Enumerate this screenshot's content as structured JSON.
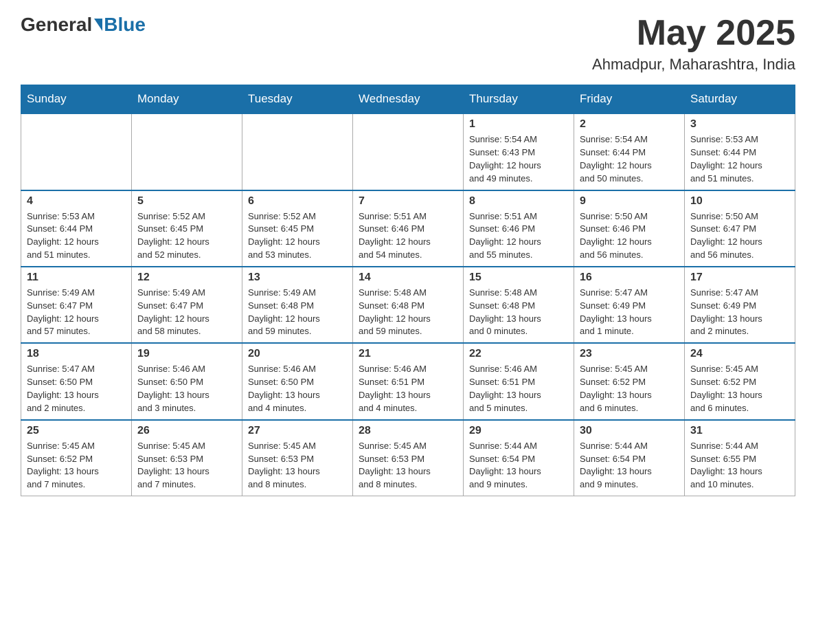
{
  "logo": {
    "general": "General",
    "blue": "Blue"
  },
  "title": "May 2025",
  "location": "Ahmadpur, Maharashtra, India",
  "headers": [
    "Sunday",
    "Monday",
    "Tuesday",
    "Wednesday",
    "Thursday",
    "Friday",
    "Saturday"
  ],
  "weeks": [
    [
      {
        "day": "",
        "info": ""
      },
      {
        "day": "",
        "info": ""
      },
      {
        "day": "",
        "info": ""
      },
      {
        "day": "",
        "info": ""
      },
      {
        "day": "1",
        "info": "Sunrise: 5:54 AM\nSunset: 6:43 PM\nDaylight: 12 hours\nand 49 minutes."
      },
      {
        "day": "2",
        "info": "Sunrise: 5:54 AM\nSunset: 6:44 PM\nDaylight: 12 hours\nand 50 minutes."
      },
      {
        "day": "3",
        "info": "Sunrise: 5:53 AM\nSunset: 6:44 PM\nDaylight: 12 hours\nand 51 minutes."
      }
    ],
    [
      {
        "day": "4",
        "info": "Sunrise: 5:53 AM\nSunset: 6:44 PM\nDaylight: 12 hours\nand 51 minutes."
      },
      {
        "day": "5",
        "info": "Sunrise: 5:52 AM\nSunset: 6:45 PM\nDaylight: 12 hours\nand 52 minutes."
      },
      {
        "day": "6",
        "info": "Sunrise: 5:52 AM\nSunset: 6:45 PM\nDaylight: 12 hours\nand 53 minutes."
      },
      {
        "day": "7",
        "info": "Sunrise: 5:51 AM\nSunset: 6:46 PM\nDaylight: 12 hours\nand 54 minutes."
      },
      {
        "day": "8",
        "info": "Sunrise: 5:51 AM\nSunset: 6:46 PM\nDaylight: 12 hours\nand 55 minutes."
      },
      {
        "day": "9",
        "info": "Sunrise: 5:50 AM\nSunset: 6:46 PM\nDaylight: 12 hours\nand 56 minutes."
      },
      {
        "day": "10",
        "info": "Sunrise: 5:50 AM\nSunset: 6:47 PM\nDaylight: 12 hours\nand 56 minutes."
      }
    ],
    [
      {
        "day": "11",
        "info": "Sunrise: 5:49 AM\nSunset: 6:47 PM\nDaylight: 12 hours\nand 57 minutes."
      },
      {
        "day": "12",
        "info": "Sunrise: 5:49 AM\nSunset: 6:47 PM\nDaylight: 12 hours\nand 58 minutes."
      },
      {
        "day": "13",
        "info": "Sunrise: 5:49 AM\nSunset: 6:48 PM\nDaylight: 12 hours\nand 59 minutes."
      },
      {
        "day": "14",
        "info": "Sunrise: 5:48 AM\nSunset: 6:48 PM\nDaylight: 12 hours\nand 59 minutes."
      },
      {
        "day": "15",
        "info": "Sunrise: 5:48 AM\nSunset: 6:48 PM\nDaylight: 13 hours\nand 0 minutes."
      },
      {
        "day": "16",
        "info": "Sunrise: 5:47 AM\nSunset: 6:49 PM\nDaylight: 13 hours\nand 1 minute."
      },
      {
        "day": "17",
        "info": "Sunrise: 5:47 AM\nSunset: 6:49 PM\nDaylight: 13 hours\nand 2 minutes."
      }
    ],
    [
      {
        "day": "18",
        "info": "Sunrise: 5:47 AM\nSunset: 6:50 PM\nDaylight: 13 hours\nand 2 minutes."
      },
      {
        "day": "19",
        "info": "Sunrise: 5:46 AM\nSunset: 6:50 PM\nDaylight: 13 hours\nand 3 minutes."
      },
      {
        "day": "20",
        "info": "Sunrise: 5:46 AM\nSunset: 6:50 PM\nDaylight: 13 hours\nand 4 minutes."
      },
      {
        "day": "21",
        "info": "Sunrise: 5:46 AM\nSunset: 6:51 PM\nDaylight: 13 hours\nand 4 minutes."
      },
      {
        "day": "22",
        "info": "Sunrise: 5:46 AM\nSunset: 6:51 PM\nDaylight: 13 hours\nand 5 minutes."
      },
      {
        "day": "23",
        "info": "Sunrise: 5:45 AM\nSunset: 6:52 PM\nDaylight: 13 hours\nand 6 minutes."
      },
      {
        "day": "24",
        "info": "Sunrise: 5:45 AM\nSunset: 6:52 PM\nDaylight: 13 hours\nand 6 minutes."
      }
    ],
    [
      {
        "day": "25",
        "info": "Sunrise: 5:45 AM\nSunset: 6:52 PM\nDaylight: 13 hours\nand 7 minutes."
      },
      {
        "day": "26",
        "info": "Sunrise: 5:45 AM\nSunset: 6:53 PM\nDaylight: 13 hours\nand 7 minutes."
      },
      {
        "day": "27",
        "info": "Sunrise: 5:45 AM\nSunset: 6:53 PM\nDaylight: 13 hours\nand 8 minutes."
      },
      {
        "day": "28",
        "info": "Sunrise: 5:45 AM\nSunset: 6:53 PM\nDaylight: 13 hours\nand 8 minutes."
      },
      {
        "day": "29",
        "info": "Sunrise: 5:44 AM\nSunset: 6:54 PM\nDaylight: 13 hours\nand 9 minutes."
      },
      {
        "day": "30",
        "info": "Sunrise: 5:44 AM\nSunset: 6:54 PM\nDaylight: 13 hours\nand 9 minutes."
      },
      {
        "day": "31",
        "info": "Sunrise: 5:44 AM\nSunset: 6:55 PM\nDaylight: 13 hours\nand 10 minutes."
      }
    ]
  ]
}
